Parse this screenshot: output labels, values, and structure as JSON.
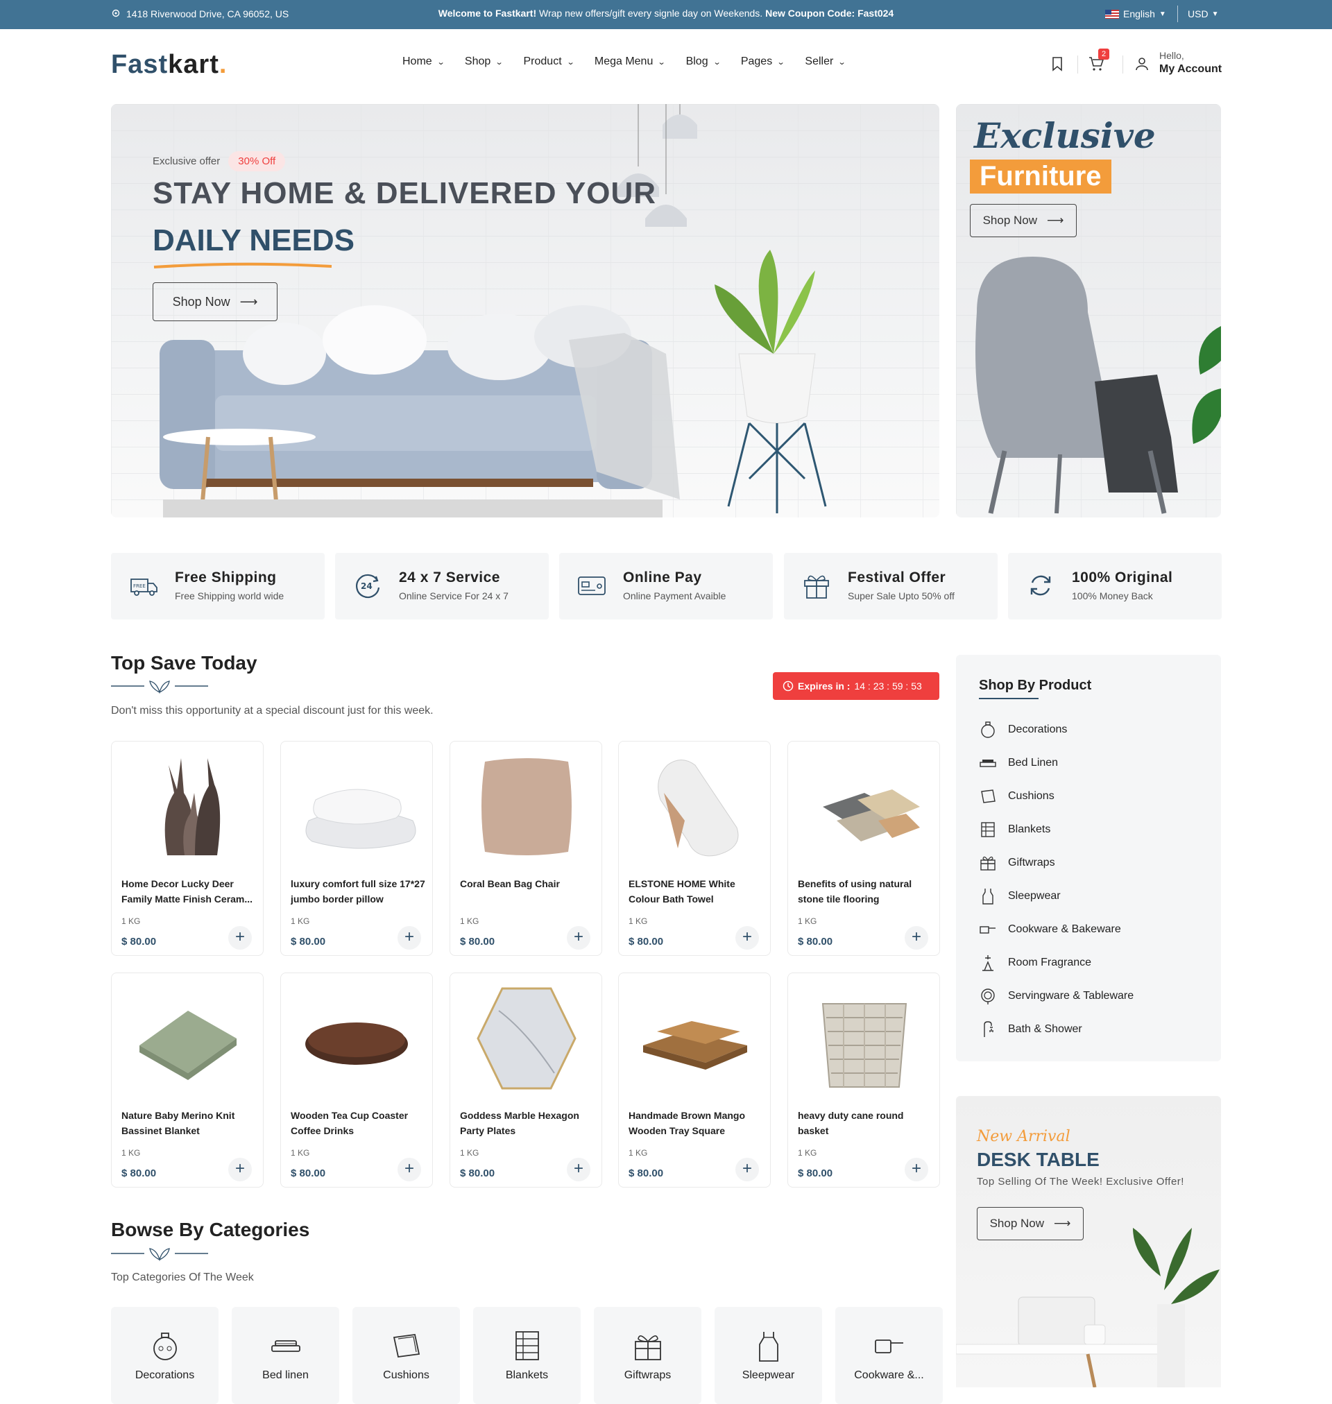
{
  "topbar": {
    "address": "1418 Riverwood Drive, CA 96052, US",
    "welcome_bold": "Welcome to Fastkart!",
    "welcome_text": " Wrap new offers/gift every signle day on Weekends. ",
    "coupon": "New Coupon Code: Fast024",
    "language": "English",
    "currency": "USD"
  },
  "header": {
    "logo_main": "Fast",
    "logo_k": "kart",
    "logo_dot": ".",
    "nav": [
      "Home",
      "Shop",
      "Product",
      "Mega Menu",
      "Blog",
      "Pages",
      "Seller"
    ],
    "cart_count": "2",
    "hello": "Hello,",
    "account": "My Account"
  },
  "hero": {
    "exclusive": "Exclusive offer",
    "discount": "30% Off",
    "line1": "STAY HOME & DELIVERED YOUR",
    "line2": "DAILY NEEDS",
    "button": "Shop Now"
  },
  "side_banner": {
    "script": "Exclusive",
    "highlight": "Furniture",
    "button": "Shop Now"
  },
  "features": [
    {
      "title": "Free Shipping",
      "sub": "Free Shipping world wide",
      "icon": "truck-icon"
    },
    {
      "title": "24 x 7 Service",
      "sub": "Online Service For 24 x 7",
      "icon": "clock-24-icon"
    },
    {
      "title": "Online Pay",
      "sub": "Online Payment Avaible",
      "icon": "card-icon"
    },
    {
      "title": "Festival Offer",
      "sub": "Super Sale Upto 50% off",
      "icon": "gift-icon"
    },
    {
      "title": "100% Original",
      "sub": "100% Money Back",
      "icon": "refresh-icon"
    }
  ],
  "top_save": {
    "title": "Top Save Today",
    "subtitle": "Don't miss this opportunity at a special discount just for this week.",
    "expires_label": "Expires in :",
    "time": "14 : 23 : 59 : 53"
  },
  "products": [
    {
      "name": "Home Decor Lucky Deer Family Matte Finish Ceram...",
      "weight": "1 KG",
      "price": "$ 80.00"
    },
    {
      "name": "luxury comfort full size 17*27 jumbo border pillow",
      "weight": "1 KG",
      "price": "$ 80.00"
    },
    {
      "name": "Coral Bean Bag Chair",
      "weight": "1 KG",
      "price": "$ 80.00"
    },
    {
      "name": "ELSTONE HOME White Colour Bath Towel",
      "weight": "1 KG",
      "price": "$ 80.00"
    },
    {
      "name": "Benefits of using natural stone tile flooring",
      "weight": "1 KG",
      "price": "$ 80.00"
    },
    {
      "name": "Nature Baby Merino Knit Bassinet Blanket",
      "weight": "1 KG",
      "price": "$ 80.00"
    },
    {
      "name": "Wooden Tea Cup Coaster Coffee Drinks",
      "weight": "1 KG",
      "price": "$ 80.00"
    },
    {
      "name": "Goddess Marble Hexagon Party Plates",
      "weight": "1 KG",
      "price": "$ 80.00"
    },
    {
      "name": "Handmade Brown Mango Wooden Tray Square",
      "weight": "1 KG",
      "price": "$ 80.00"
    },
    {
      "name": "heavy duty cane round basket",
      "weight": "1 KG",
      "price": "$ 80.00"
    }
  ],
  "shop_by_product": {
    "title": "Shop By Product",
    "items": [
      "Decorations",
      "Bed Linen",
      "Cushions",
      "Blankets",
      "Giftwraps",
      "Sleepwear",
      "Cookware & Bakeware",
      "Room Fragrance",
      "Servingware & Tableware",
      "Bath & Shower"
    ]
  },
  "new_arrival": {
    "script": "New Arrival",
    "title": "DESK TABLE",
    "sub": "Top Selling Of The Week! Exclusive Offer!",
    "button": "Shop Now"
  },
  "categories": {
    "title": "Bowse By Categories",
    "subtitle": "Top Categories Of The Week",
    "items": [
      "Decorations",
      "Bed linen",
      "Cushions",
      "Blankets",
      "Giftwraps",
      "Sleepwear",
      "Cookware &..."
    ]
  },
  "colors": {
    "primary": "#30506a",
    "topbar": "#417394",
    "accent": "#f39c3b",
    "danger": "#ef3f3e"
  }
}
